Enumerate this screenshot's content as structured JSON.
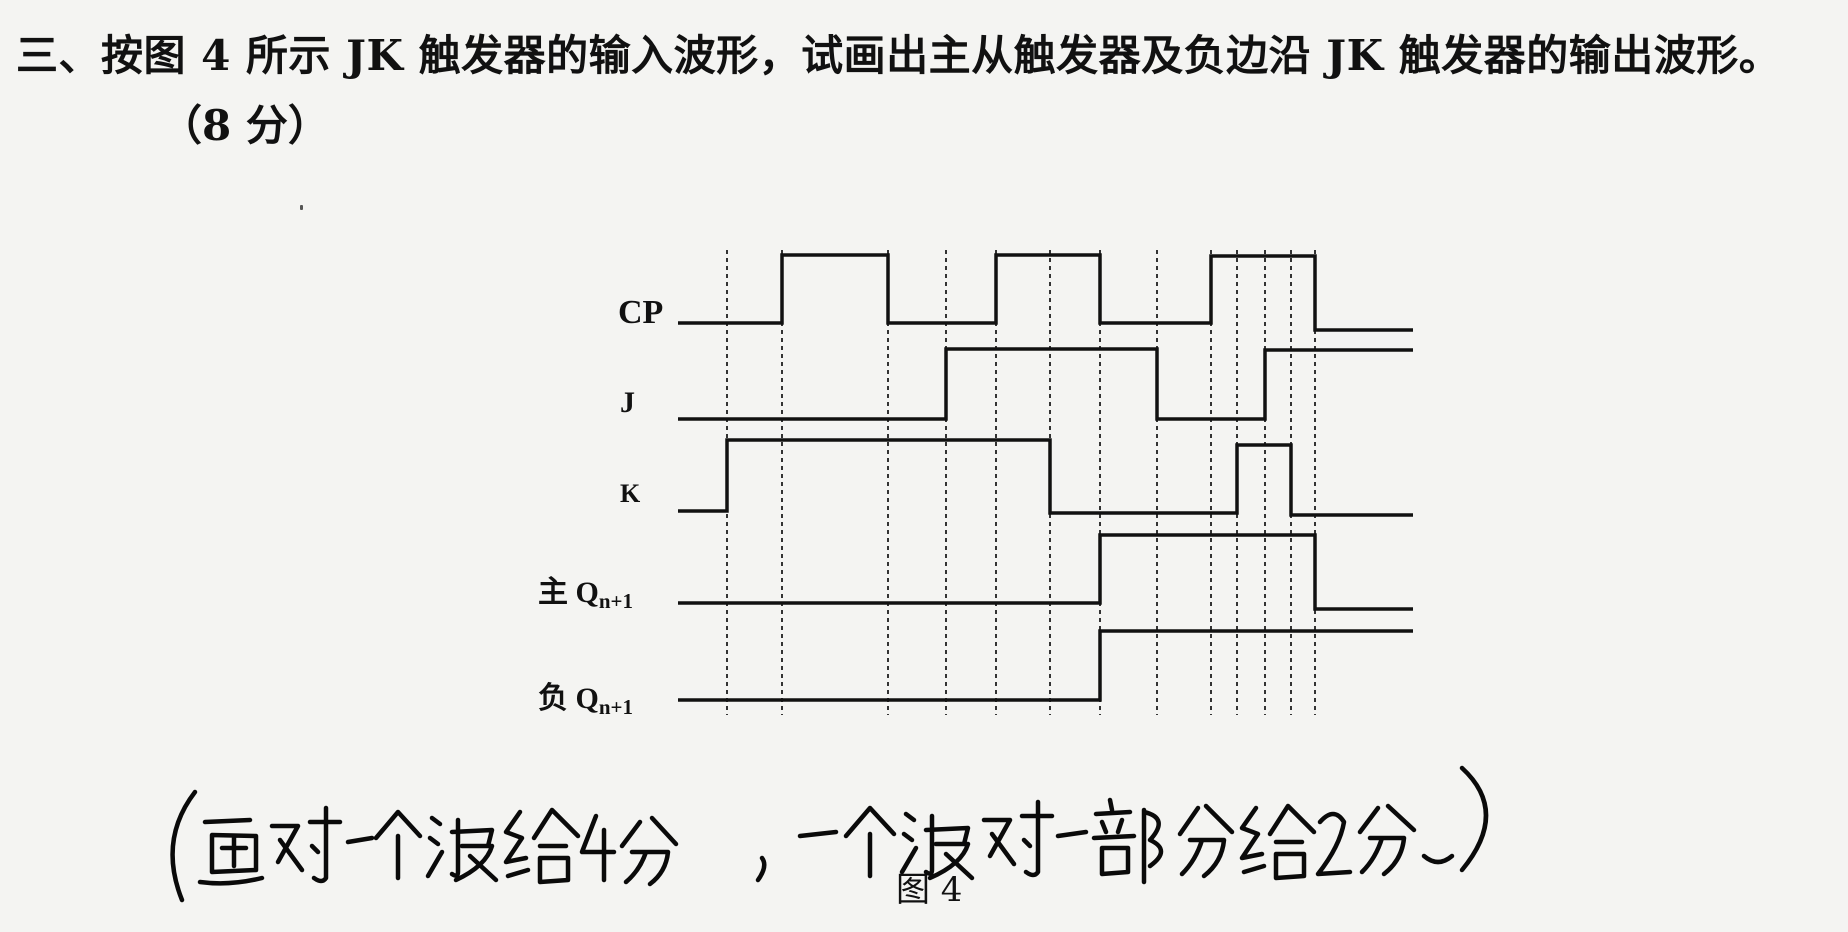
{
  "question": {
    "text": "三、按图 4 所示 JK 触发器的输入波形，试画出主从触发器及负边沿 JK 触发器的输出波形。",
    "points": "（8 分）"
  },
  "figure": {
    "caption": "图 4",
    "signals": [
      {
        "name": "CP",
        "label": "CP"
      },
      {
        "name": "J",
        "label": "J"
      },
      {
        "name": "K",
        "label": "K"
      },
      {
        "name": "master-slave-q",
        "label": "主 Q",
        "label_sub": "n+1"
      },
      {
        "name": "negative-edge-q",
        "label": "负 Q",
        "label_sub": "n+1"
      }
    ]
  },
  "annotation": {
    "handwritten_note": "（画对一个波给4分，一个波对一部分给2分。）"
  }
}
